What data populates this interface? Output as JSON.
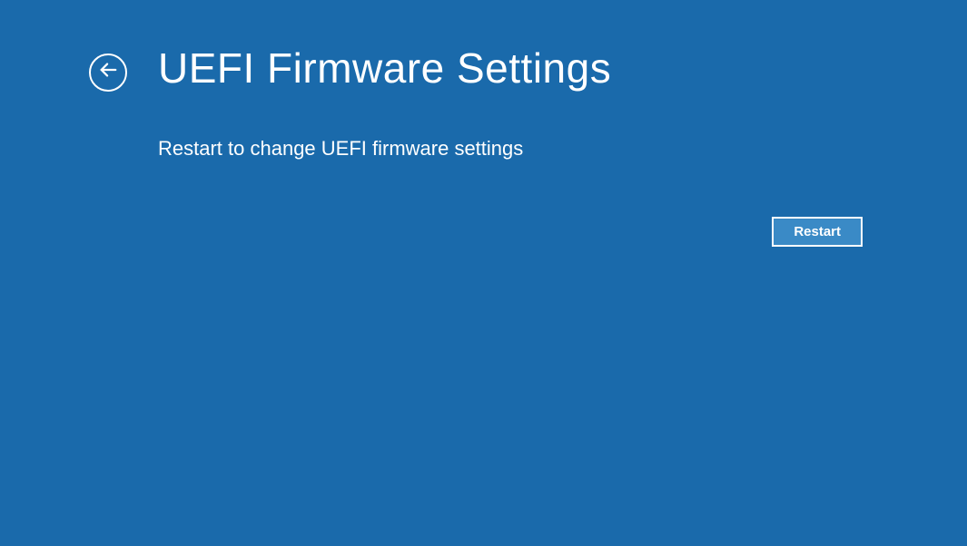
{
  "header": {
    "title": "UEFI Firmware Settings"
  },
  "main": {
    "description": "Restart to change UEFI firmware settings",
    "restart_label": "Restart"
  }
}
